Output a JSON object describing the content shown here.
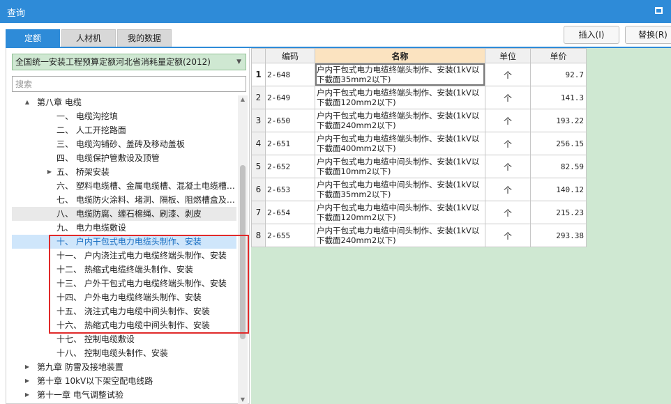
{
  "window": {
    "title": "查询"
  },
  "tabs": [
    {
      "label": "定额",
      "active": true
    },
    {
      "label": "人材机",
      "active": false
    },
    {
      "label": "我的数据",
      "active": false
    }
  ],
  "toolbar": {
    "insert_label": "插入(I)",
    "replace_label": "替换(R)"
  },
  "left_panel": {
    "quota_select": "全国统一安装工程预算定额河北省消耗量定额(2012)",
    "search_placeholder": "搜索",
    "tree": [
      {
        "label": "第八章 电缆",
        "level": 0,
        "toggle": "▲"
      },
      {
        "label": "一、 电缆沟挖填",
        "level": 1
      },
      {
        "label": "二、 人工开挖路面",
        "level": 1
      },
      {
        "label": "三、 电缆沟铺砂、盖砖及移动盖板",
        "level": 1
      },
      {
        "label": "四、 电缆保护管敷设及顶管",
        "level": 1
      },
      {
        "label": "五、 桥架安装",
        "level": 1,
        "toggle": "▶"
      },
      {
        "label": "六、 塑料电缆槽、金属电缆槽、混凝土电缆槽…",
        "level": 1
      },
      {
        "label": "七、 电缆防火涂料、堵洞、隔板、阻燃槽盒及…",
        "level": 1
      },
      {
        "label": "八、 电缆防腐、缠石棉绳、刷漆、剥皮",
        "level": 1,
        "state": "gray"
      },
      {
        "label": "九、 电力电缆敷设",
        "level": 1
      },
      {
        "label": "十、 户内干包式电力电缆头制作、安装",
        "level": 1,
        "state": "sel"
      },
      {
        "label": "十一、 户内浇注式电力电缆终端头制作、安装",
        "level": 1
      },
      {
        "label": "十二、 热缩式电缆终端头制作、安装",
        "level": 1
      },
      {
        "label": "十三、 户外干包式电力电缆终端头制作、安装",
        "level": 1
      },
      {
        "label": "十四、 户外电力电缆终端头制作、安装",
        "level": 1
      },
      {
        "label": "十五、 浇注式电力电缆中间头制作、安装",
        "level": 1
      },
      {
        "label": "十六、 热缩式电力电缆中间头制作、安装",
        "level": 1
      },
      {
        "label": "十七、 控制电缆敷设",
        "level": 1
      },
      {
        "label": "十八、 控制电缆头制作、安装",
        "level": 1
      },
      {
        "label": "第九章 防雷及接地装置",
        "level": 0,
        "toggle": "▶"
      },
      {
        "label": "第十章 10kV以下架空配电线路",
        "level": 0,
        "toggle": "▶"
      },
      {
        "label": "第十一章 电气调整试验",
        "level": 0,
        "toggle": "▶"
      }
    ]
  },
  "grid": {
    "columns": [
      "编码",
      "名称",
      "单位",
      "单价"
    ],
    "rows": [
      {
        "no": "1",
        "code": "2-648",
        "name": "户内干包式电力电缆终端头制作、安装(1kV以下截面35mm2以下)",
        "unit": "个",
        "price": "92.7"
      },
      {
        "no": "2",
        "code": "2-649",
        "name": "户内干包式电力电缆终端头制作、安装(1kV以下截面120mm2以下)",
        "unit": "个",
        "price": "141.3"
      },
      {
        "no": "3",
        "code": "2-650",
        "name": "户内干包式电力电缆终端头制作、安装(1kV以下截面240mm2以下)",
        "unit": "个",
        "price": "193.22"
      },
      {
        "no": "4",
        "code": "2-651",
        "name": "户内干包式电力电缆终端头制作、安装(1kV以下截面400mm2以下)",
        "unit": "个",
        "price": "256.15"
      },
      {
        "no": "5",
        "code": "2-652",
        "name": "户内干包式电力电缆中间头制作、安装(1kV以下截面10mm2以下)",
        "unit": "个",
        "price": "82.59"
      },
      {
        "no": "6",
        "code": "2-653",
        "name": "户内干包式电力电缆中间头制作、安装(1kV以下截面35mm2以下)",
        "unit": "个",
        "price": "140.12"
      },
      {
        "no": "7",
        "code": "2-654",
        "name": "户内干包式电力电缆中间头制作、安装(1kV以下截面120mm2以下)",
        "unit": "个",
        "price": "215.23"
      },
      {
        "no": "8",
        "code": "2-655",
        "name": "户内干包式电力电缆中间头制作、安装(1kV以下截面240mm2以下)",
        "unit": "个",
        "price": "293.38"
      }
    ]
  }
}
